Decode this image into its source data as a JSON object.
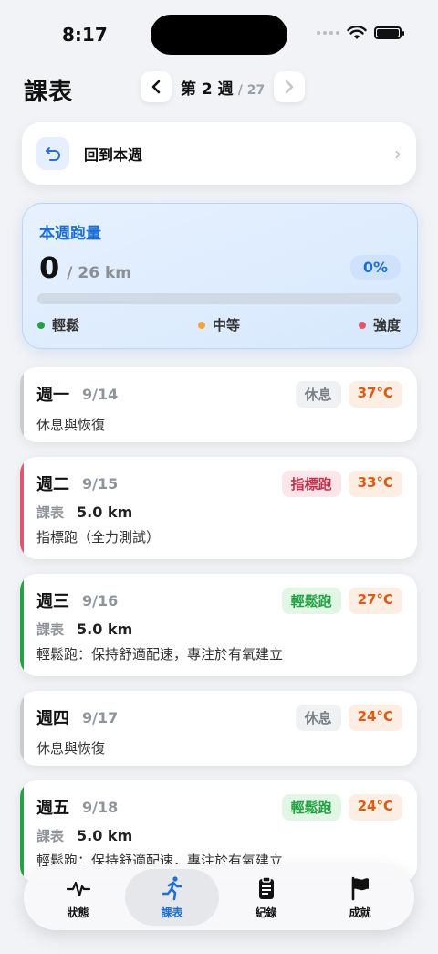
{
  "status": {
    "time": "8:17"
  },
  "header": {
    "title": "課表",
    "week_label": "第 2 週",
    "week_total": "/ 27"
  },
  "return_card": {
    "label": "回到本週"
  },
  "weekly": {
    "title": "本週跑量",
    "value": "0",
    "goal": "/ 26 km",
    "percent": "0%",
    "progress": 0,
    "legend": [
      {
        "label": "輕鬆",
        "color": "#23a244"
      },
      {
        "label": "中等",
        "color": "#f4a23b"
      },
      {
        "label": "強度",
        "color": "#e1566c"
      }
    ]
  },
  "days": [
    {
      "name": "週一",
      "date": "9/14",
      "type_badge": "休息",
      "temp": "37°C",
      "note": "休息與恢復",
      "course_label": "",
      "distance": ""
    },
    {
      "name": "週二",
      "date": "9/15",
      "type_badge": "指標跑",
      "temp": "33°C",
      "course_label": "課表",
      "distance": "5.0 km",
      "note": "指標跑（全力測試）"
    },
    {
      "name": "週三",
      "date": "9/16",
      "type_badge": "輕鬆跑",
      "temp": "27°C",
      "course_label": "課表",
      "distance": "5.0 km",
      "note": "輕鬆跑：保持舒適配速，專注於有氧建立"
    },
    {
      "name": "週四",
      "date": "9/17",
      "type_badge": "休息",
      "temp": "24°C",
      "note": "休息與恢復",
      "course_label": "",
      "distance": ""
    },
    {
      "name": "週五",
      "date": "9/18",
      "type_badge": "輕鬆跑",
      "temp": "24°C",
      "course_label": "課表",
      "distance": "5.0 km",
      "note": "輕鬆跑：保持舒適配速，專注於有氧建立"
    }
  ],
  "tabs": [
    {
      "label": "狀態",
      "icon": "pulse-icon"
    },
    {
      "label": "課表",
      "icon": "runner-icon"
    },
    {
      "label": "紀錄",
      "icon": "clipboard-icon"
    },
    {
      "label": "成就",
      "icon": "flag-icon"
    }
  ]
}
